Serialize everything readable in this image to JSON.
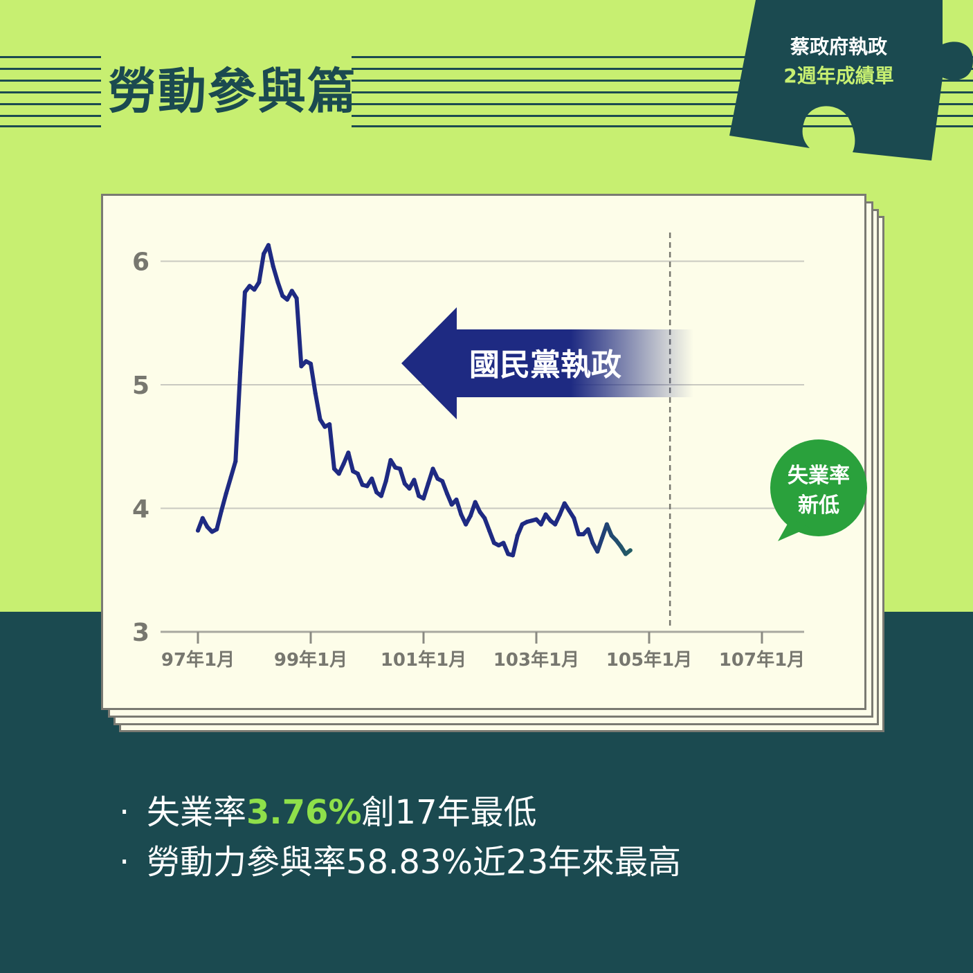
{
  "header": {
    "title": "勞動參與篇",
    "badge_line1": "蔡政府執政",
    "badge_line2": "2週年成績單"
  },
  "colors": {
    "background": "#c7ef71",
    "band": "#1b4a50",
    "paper": "#fdfde9",
    "kmt_blue": "#1e2a82",
    "dpp_green": "#2aa13c",
    "callout_green": "#2aa13c"
  },
  "chart_data": {
    "type": "line",
    "title": "",
    "xlabel": "",
    "ylabel": "",
    "ylim": [
      3,
      6.2
    ],
    "yticks": [
      "3",
      "4",
      "5",
      "6"
    ],
    "xticks": [
      "97年1月",
      "99年1月",
      "101年1月",
      "103年1月",
      "105年1月",
      "107年1月"
    ],
    "x_start": "97年1月",
    "x_interval": "month",
    "series": [
      {
        "name": "",
        "values": [
          3.82,
          3.92,
          3.85,
          3.81,
          3.83,
          3.98,
          4.12,
          4.25,
          4.38,
          5.1,
          5.75,
          5.8,
          5.77,
          5.83,
          6.06,
          6.13,
          5.96,
          5.83,
          5.72,
          5.69,
          5.76,
          5.7,
          5.15,
          5.19,
          5.17,
          4.93,
          4.72,
          4.66,
          4.68,
          4.32,
          4.28,
          4.36,
          4.45,
          4.3,
          4.28,
          4.19,
          4.18,
          4.24,
          4.13,
          4.1,
          4.22,
          4.39,
          4.33,
          4.32,
          4.2,
          4.16,
          4.23,
          4.1,
          4.08,
          4.2,
          4.32,
          4.24,
          4.22,
          4.12,
          4.03,
          4.07,
          3.95,
          3.87,
          3.94,
          4.05,
          3.97,
          3.92,
          3.82,
          3.72,
          3.7,
          3.72,
          3.63,
          3.62,
          3.78,
          3.87,
          3.89,
          3.9,
          3.91,
          3.87,
          3.95,
          3.9,
          3.87,
          3.95,
          4.04,
          3.98,
          3.92,
          3.79,
          3.79,
          3.83,
          3.72,
          3.65,
          3.76,
          3.87,
          3.78,
          3.74,
          3.69,
          3.63,
          3.66
        ]
      }
    ],
    "annotations": {
      "kmt_arrow_label": "國民黨執政",
      "callout_line1": "失業率",
      "callout_line2": "新低"
    },
    "dpp_start": "105年5月",
    "grid": true,
    "legend": "none"
  },
  "bullets": [
    {
      "prefix": "失業率",
      "highlight": "3.76%",
      "suffix": "創17年最低"
    },
    {
      "prefix": "勞動力參與率58.83%近23年來最高",
      "highlight": "",
      "suffix": ""
    }
  ],
  "bullet_dot": "·"
}
